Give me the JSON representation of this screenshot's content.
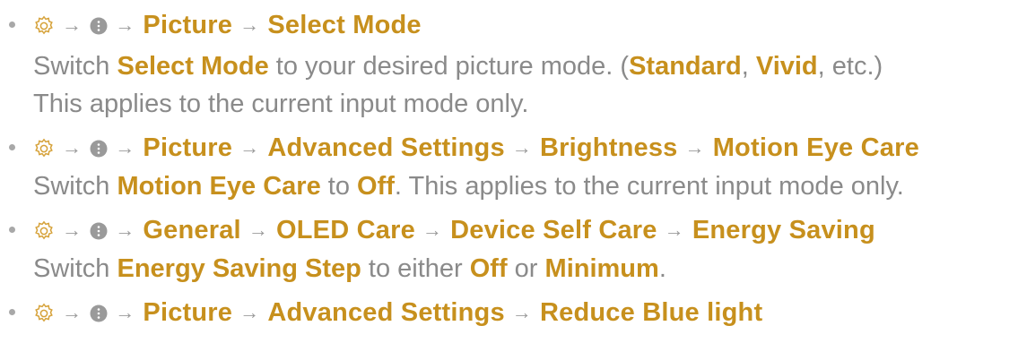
{
  "colors": {
    "accent": "#c7901d",
    "text": "#8a8a8a",
    "icon": "#d6a23a",
    "menu_dot": "#9a9a9a"
  },
  "icons": [
    "settings-gear-icon",
    "more-menu-icon",
    "arrow-right-icon"
  ],
  "arrow": "→",
  "items": [
    {
      "path": [
        "Picture",
        "Select Mode"
      ],
      "desc1": {
        "p1": "Switch ",
        "h1": "Select Mode",
        "p2": " to your desired picture mode. (",
        "h2": "Standard",
        "p3": ", ",
        "h3": "Vivid",
        "p4": ", etc.)"
      },
      "desc2": "This applies to the current input mode only."
    },
    {
      "path": [
        "Picture",
        "Advanced Settings",
        "Brightness",
        "Motion Eye Care"
      ],
      "desc1": {
        "p1": "Switch ",
        "h1": "Motion Eye Care",
        "p2": " to ",
        "h2": "Off",
        "p3": ". This applies to the current input mode only."
      }
    },
    {
      "path": [
        "General",
        "OLED Care",
        "Device Self Care",
        "Energy Saving"
      ],
      "desc1": {
        "p1": "Switch ",
        "h1": "Energy Saving Step",
        "p2": " to either ",
        "h2": "Off",
        "p3": " or ",
        "h3": "Minimum",
        "p4": "."
      }
    },
    {
      "path": [
        "Picture",
        "Advanced Settings",
        "Reduce Blue light"
      ]
    }
  ]
}
